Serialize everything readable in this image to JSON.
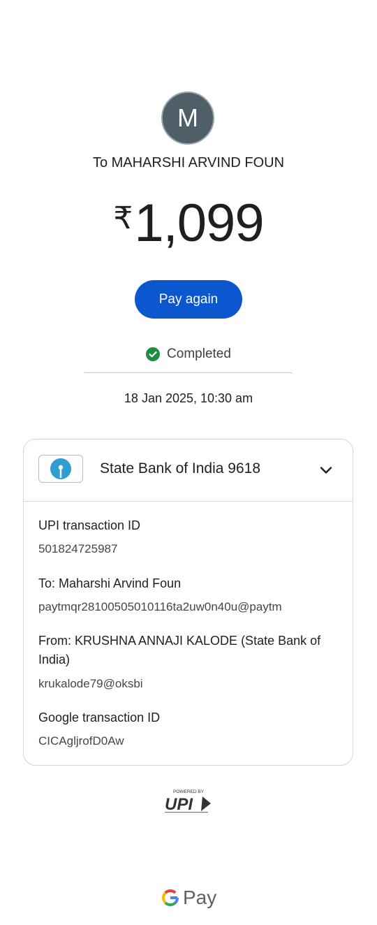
{
  "avatar": {
    "initial": "M",
    "color": "#4f5f68"
  },
  "payee": {
    "label": "To MAHARSHI ARVIND FOUN"
  },
  "amount": {
    "currency": "₹",
    "value": "1,099"
  },
  "actions": {
    "pay_again_label": "Pay again",
    "accent": "#0b57d0"
  },
  "status": {
    "label": "Completed",
    "icon": "check-circle-icon",
    "color": "#1e8e3e"
  },
  "datetime": "18 Jan 2025, 10:30 am",
  "bank": {
    "name": "State Bank of India 9618",
    "logo": "sbi-logo-icon",
    "logo_color": "#2f9fcf"
  },
  "details": [
    {
      "label": "UPI transaction ID",
      "value": "501824725987"
    },
    {
      "label": "To: Maharshi Arvind Foun",
      "value": "paytmqr28100505010116ta2uw0n40u@paytm"
    },
    {
      "label": "From: KRUSHNA ANNAJI KALODE (State Bank of India)",
      "value": "krukalode79@oksbi"
    },
    {
      "label": "Google transaction ID",
      "value": "CICAgljrofD0Aw"
    }
  ],
  "footer": {
    "upi_powered_by": "POWERED BY",
    "upi_logo_text": "UPI",
    "gpay_label": "Pay"
  }
}
